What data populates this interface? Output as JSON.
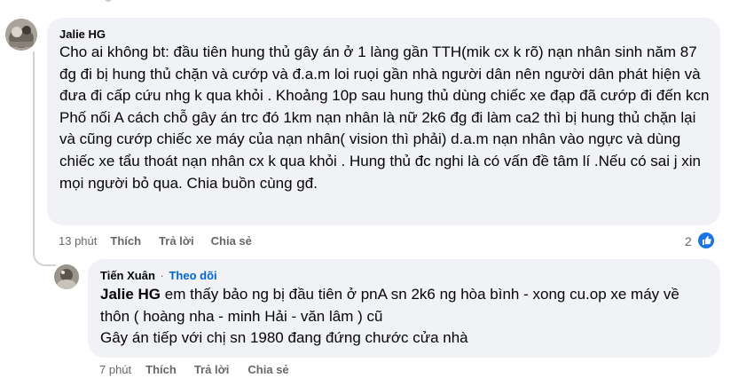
{
  "comments": [
    {
      "author": "Jalie HG",
      "text": "Cho ai không bt: đầu tiên hung thủ gây án ở 1 làng gần TTH(mik cx k rõ) nạn nhân sinh năm 87 đg đi bị hung thủ chặn và cướp và đ.a.m loi ruọi gần nhà người dân nên người dân phát hiện và đưa đi cấp cứu nhg k qua khỏi . Khoảng 10p sau hung thủ dùng chiếc xe đạp đã cướp đi đến kcn Phố nối A cách chỗ gây án trc đó 1km nạn nhân là nữ 2k6 đg đi làm ca2 thì bị hung thủ chặn lại và cũng cướp chiếc xe máy của nạn nhân( vision thì phải) d.a.m nạn nhân vào ngực và dùng chiếc xe tẩu thoát nạn nhân cx k qua khỏi . Hung thủ đc nghi là có vấn đề tâm lí .Nếu có sai j xin mọi người bỏ qua. Chia buồn cùng gđ.",
      "time": "13 phút",
      "like_label": "Thích",
      "reply_label": "Trả lời",
      "share_label": "Chia sẻ",
      "reaction_count": "2",
      "reaction_icon": "thumbs-up-icon"
    },
    {
      "author": "Tiến Xuân",
      "separator": "·",
      "follow_label": "Theo dõi",
      "mention": "Jalie HG",
      "text_line1": " em thấy bảo ng bị đầu tiên ở pnA sn 2k6 ng hòa bình - xong cu.op xe máy về thôn ( hoàng nha - minh Hải - văn lâm ) cũ",
      "text_line2": "Gây án tiếp với chị sn 1980 đang đứng chước cửa nhà",
      "time": "7 phút",
      "like_label": "Thích",
      "reply_label": "Trả lời",
      "share_label": "Chia sẻ"
    }
  ],
  "colors": {
    "bubble": "#f0f2f5",
    "meta_text": "#65676b",
    "link_blue": "#0064d1",
    "reaction_blue": "#1b74e4"
  }
}
